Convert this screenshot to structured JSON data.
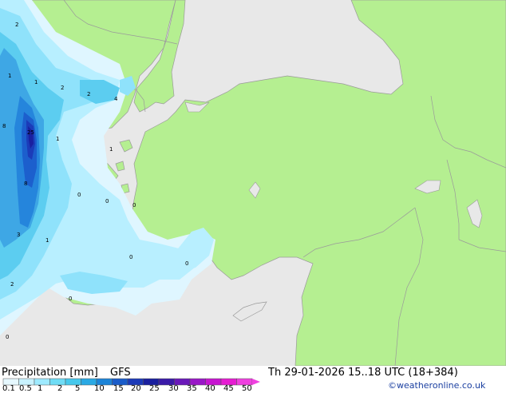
{
  "map": {
    "precip_labels": [
      {
        "text": "2"
      },
      {
        "text": "1"
      },
      {
        "text": "1"
      },
      {
        "text": "2"
      },
      {
        "text": "2"
      },
      {
        "text": "4"
      },
      {
        "text": "8"
      },
      {
        "text": "25"
      },
      {
        "text": "1"
      },
      {
        "text": "1"
      },
      {
        "text": "8"
      },
      {
        "text": "0"
      },
      {
        "text": "0"
      },
      {
        "text": "0"
      },
      {
        "text": "3"
      },
      {
        "text": "1"
      },
      {
        "text": "0"
      },
      {
        "text": "0"
      },
      {
        "text": "2"
      },
      {
        "text": "0"
      },
      {
        "text": "0"
      }
    ],
    "colors": {
      "sea": "#e8e8e8",
      "land": "#b5ef91",
      "border": "#9a9a9a"
    }
  },
  "footer": {
    "title": "Precipitation [mm]",
    "model": "GFS",
    "valid_time": "Th 29-01-2026 15..18 UTC (18+384)",
    "credit": "©weatheronline.co.uk",
    "scale_colors": [
      "#e6f8ff",
      "#c8f2ff",
      "#9eeaff",
      "#6fdcf5",
      "#46c8ec",
      "#2aa9e4",
      "#1c84d8",
      "#1a5cc9",
      "#1c3ab8",
      "#1a1f9e",
      "#3a1aa8",
      "#6a18b9",
      "#9916c7",
      "#c715d1",
      "#e61cd2",
      "#f040e0"
    ],
    "scale_ticks": [
      "0.1",
      "0.5",
      "1",
      "2",
      "5",
      "10",
      "15",
      "20",
      "25",
      "30",
      "35",
      "40",
      "45",
      "50"
    ]
  }
}
